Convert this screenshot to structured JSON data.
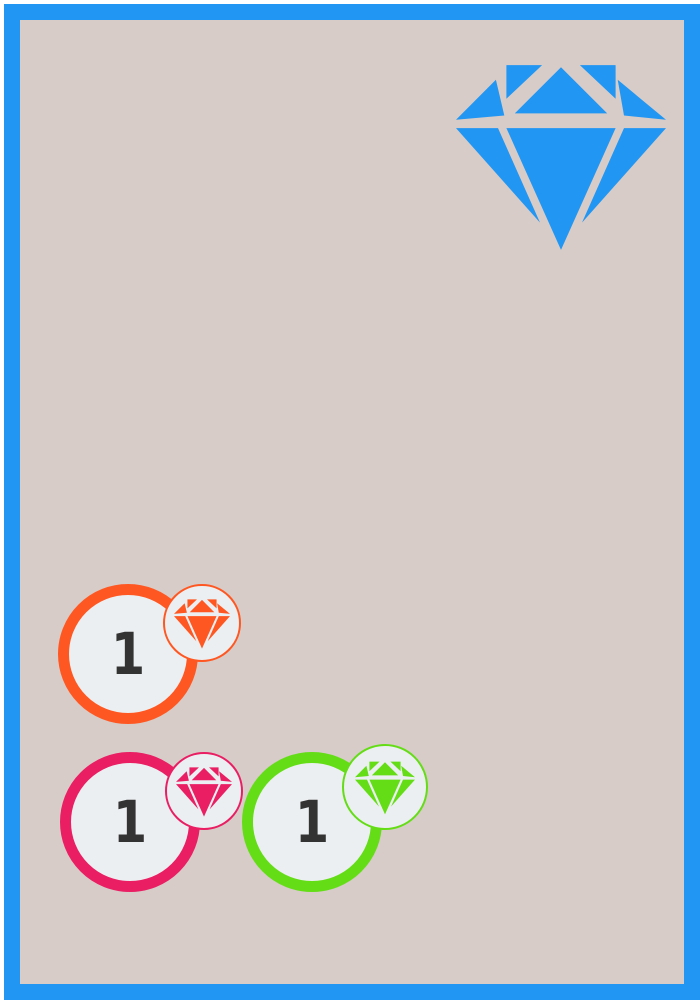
{
  "card": {
    "border_color": "#2196f3",
    "background_color": "#d7ccc8",
    "gem_icon": "diamond-icon",
    "gem_color": "#2196f3"
  },
  "costs": [
    {
      "gem": "orange",
      "color": "#ff5722",
      "amount": "1"
    },
    {
      "gem": "pink",
      "color": "#e91e63",
      "amount": "1"
    },
    {
      "gem": "green",
      "color": "#64dd17",
      "amount": "1"
    }
  ]
}
